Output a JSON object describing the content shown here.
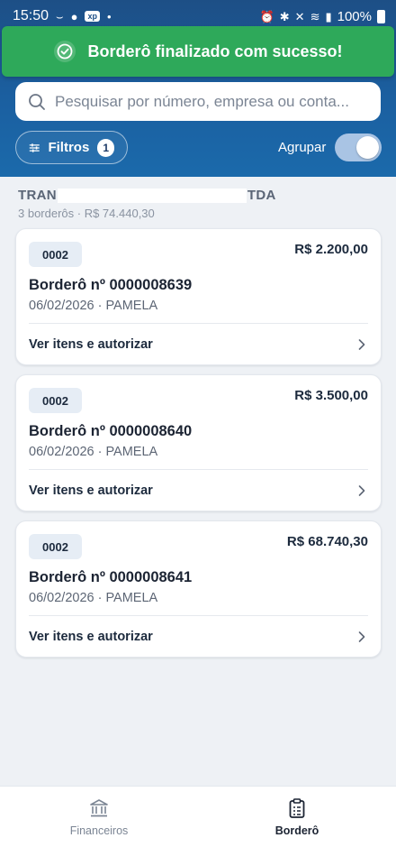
{
  "status_bar": {
    "time": "15:50",
    "battery": "100%"
  },
  "toast": {
    "message": "Borderô finalizado com sucesso!"
  },
  "search": {
    "placeholder": "Pesquisar por número, empresa ou conta..."
  },
  "filters": {
    "label": "Filtros",
    "count": "1"
  },
  "group_toggle": {
    "label": "Agrupar",
    "on": true
  },
  "group": {
    "title_start": "TRAN",
    "title_end": "TDA",
    "subtitle": "3 borderôs · R$ 74.440,30"
  },
  "cards": [
    {
      "code": "0002",
      "amount": "R$ 2.200,00",
      "title": "Borderô nº 0000008639",
      "meta": "06/02/2026 · PAMELA",
      "action": "Ver itens e autorizar"
    },
    {
      "code": "0002",
      "amount": "R$ 3.500,00",
      "title": "Borderô nº 0000008640",
      "meta": "06/02/2026 · PAMELA",
      "action": "Ver itens e autorizar"
    },
    {
      "code": "0002",
      "amount": "R$ 68.740,30",
      "title": "Borderô nº 0000008641",
      "meta": "06/02/2026 · PAMELA",
      "action": "Ver itens e autorizar"
    }
  ],
  "bottom_nav": {
    "items": [
      {
        "label": "Financeiros",
        "icon": "bank-icon",
        "active": false
      },
      {
        "label": "Borderô",
        "icon": "clipboard-icon",
        "active": true
      }
    ]
  },
  "colors": {
    "header_top": "#1d4f86",
    "header_bottom": "#1b6aab",
    "toast_green": "#2ea95a",
    "background": "#eef1f5"
  }
}
